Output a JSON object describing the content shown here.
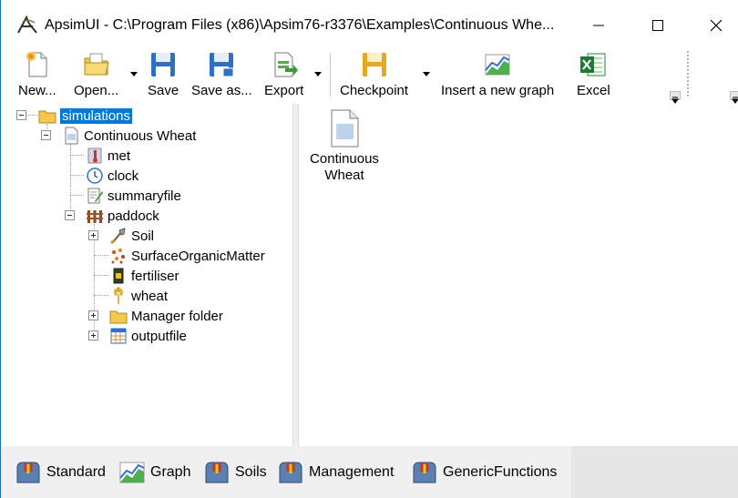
{
  "window": {
    "title": "ApsimUI - C:\\Program Files (x86)\\Apsim76-r3376\\Examples\\Continuous Whe...",
    "minimize_glyph": "—",
    "maximize_glyph": "☐",
    "close_glyph": "✕"
  },
  "toolbar": {
    "new_label": "New...",
    "open_label": "Open...",
    "save_label": "Save",
    "save_as_label": "Save as...",
    "export_label": "Export",
    "checkpoint_label": "Checkpoint",
    "insert_graph_label": "Insert a new graph",
    "excel_label": "Excel"
  },
  "tree": {
    "root": "simulations",
    "simulation": "Continuous Wheat",
    "met": "met",
    "clock": "clock",
    "summaryfile": "summaryfile",
    "paddock": "paddock",
    "soil": "Soil",
    "surface_om": "SurfaceOrganicMatter",
    "fertiliser": "fertiliser",
    "wheat": "wheat",
    "manager_folder": "Manager folder",
    "outputfile": "outputfile"
  },
  "content": {
    "item_label": "Continuous Wheat"
  },
  "bottom_tabs": {
    "standard": "Standard",
    "graph": "Graph",
    "soils": "Soils",
    "management": "Management",
    "generic_functions": "GenericFunctions"
  },
  "colors": {
    "selection": "#0078d7",
    "window_border": "#1e6fc4",
    "tab_strip": "#f0f0f0"
  }
}
